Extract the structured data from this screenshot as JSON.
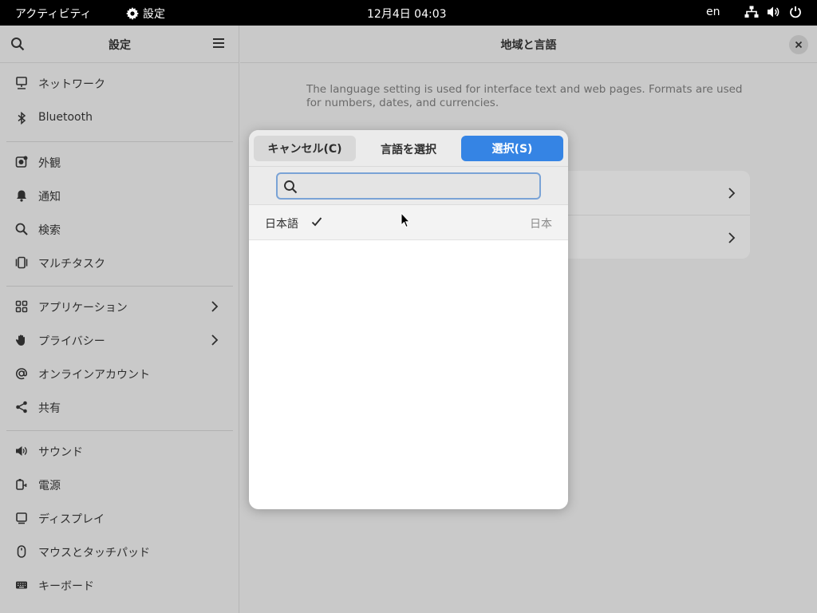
{
  "topbar": {
    "activities": "アクティビティ",
    "app_name": "設定",
    "clock": "12月4日  04:03",
    "input_lang": "en"
  },
  "sidebar": {
    "title": "設定",
    "items": [
      {
        "label": "ネットワーク"
      },
      {
        "label": "Bluetooth"
      },
      {
        "label": "外観"
      },
      {
        "label": "通知"
      },
      {
        "label": "検索"
      },
      {
        "label": "マルチタスク"
      },
      {
        "label": "アプリケーション"
      },
      {
        "label": "プライバシー"
      },
      {
        "label": "オンラインアカウント"
      },
      {
        "label": "共有"
      },
      {
        "label": "サウンド"
      },
      {
        "label": "電源"
      },
      {
        "label": "ディスプレイ"
      },
      {
        "label": "マウスとタッチパッド"
      },
      {
        "label": "キーボード"
      }
    ]
  },
  "content": {
    "title": "地域と言語",
    "description": "The language setting is used for interface text and web pages. Formats are used for numbers, dates, and currencies."
  },
  "dialog": {
    "cancel_label": "キャンセル(C)",
    "title": "言語を選択",
    "select_label": "選択(S)",
    "search_value": "",
    "languages": [
      {
        "name": "日本語",
        "region": "日本",
        "selected": true
      }
    ]
  },
  "colors": {
    "accent": "#3584e4",
    "topbar": "#000000",
    "window_dimmed": "#c9c9c9"
  }
}
